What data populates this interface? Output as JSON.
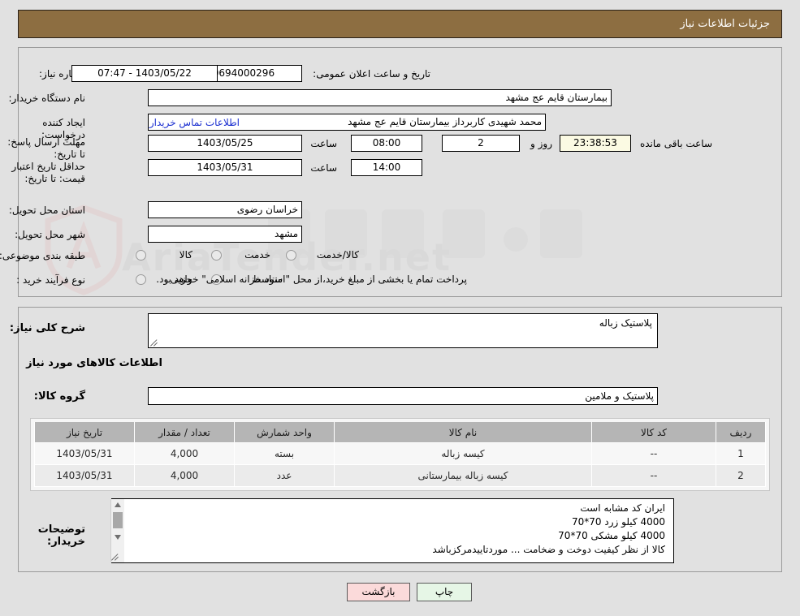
{
  "header": {
    "title": "جزئیات اطلاعات نیاز"
  },
  "need": {
    "number_label": "شماره نیاز:",
    "number_value": "1103090694000296",
    "announce_label": "تاریخ و ساعت اعلان عمومی:",
    "announce_value": "1403/05/22 - 07:47",
    "buyer_org_label": "نام دستگاه خریدار:",
    "buyer_org_value": "بیمارستان قایم  عج  مشهد",
    "creator_label": "ایجاد کننده درخواست:",
    "creator_value": "محمد شهیدی کاربرداز بیمارستان قایم  عج  مشهد",
    "contact_link": "اطلاعات تماس خریدار",
    "deadline_label": "مهلت ارسال پاسخ: تا تاریخ:",
    "deadline_date": "1403/05/25",
    "deadline_hour_label": "ساعت",
    "deadline_hour": "08:00",
    "remaining_days": "2",
    "remaining_days_label": "روز و",
    "remaining_time": "23:38:53",
    "remaining_time_label": "ساعت باقی مانده",
    "validity_label": "حداقل تاریخ اعتبار قیمت: تا تاریخ:",
    "validity_date": "1403/05/31",
    "validity_hour_label": "ساعت",
    "validity_hour": "14:00",
    "province_label": "استان محل تحویل:",
    "province_value": "خراسان رضوی",
    "city_label": "شهر محل تحویل:",
    "city_value": "مشهد",
    "category_label": "طبقه بندی موضوعی:",
    "category_options": [
      "کالا",
      "خدمت",
      "کالا/خدمت"
    ],
    "process_label": "نوع فرآیند خرید :",
    "process_options": [
      "جزیی",
      "متوسط"
    ],
    "treasury_note": "پرداخت تمام یا بخشی از مبلغ خرید،از محل \"اسناد خزانه اسلامی\" خواهد بود."
  },
  "description": {
    "summary_label": "شرح کلی نیاز:",
    "summary_value": "پلاستیک  زباله",
    "goods_section_title": "اطلاعات کالاهای مورد نیاز",
    "group_label": "گروه کالا:",
    "group_value": "پلاستیک و ملامین"
  },
  "table": {
    "columns": [
      "ردیف",
      "کد کالا",
      "نام کالا",
      "واحد شمارش",
      "تعداد / مقدار",
      "تاریخ نیاز"
    ],
    "rows": [
      {
        "row": "1",
        "code": "--",
        "name": "کیسه زباله",
        "unit": "بسته",
        "qty": "4,000",
        "date": "1403/05/31"
      },
      {
        "row": "2",
        "code": "--",
        "name": "کیسه زباله بیمارستانی",
        "unit": "عدد",
        "qty": "4,000",
        "date": "1403/05/31"
      }
    ]
  },
  "notes": {
    "label": "توضیحات خریدار:",
    "lines": [
      "ایران کد مشابه است",
      "4000 کیلو زرد 70*70",
      "4000 کیلو مشکی 70*70",
      "کالا  از نظر کیفیت  دوخت و ضخامت ... موردتاییدمرکزباشد"
    ]
  },
  "footer": {
    "print_label": "چاپ",
    "back_label": "بازگشت"
  },
  "watermark": {
    "text": "AriaTender.net"
  }
}
